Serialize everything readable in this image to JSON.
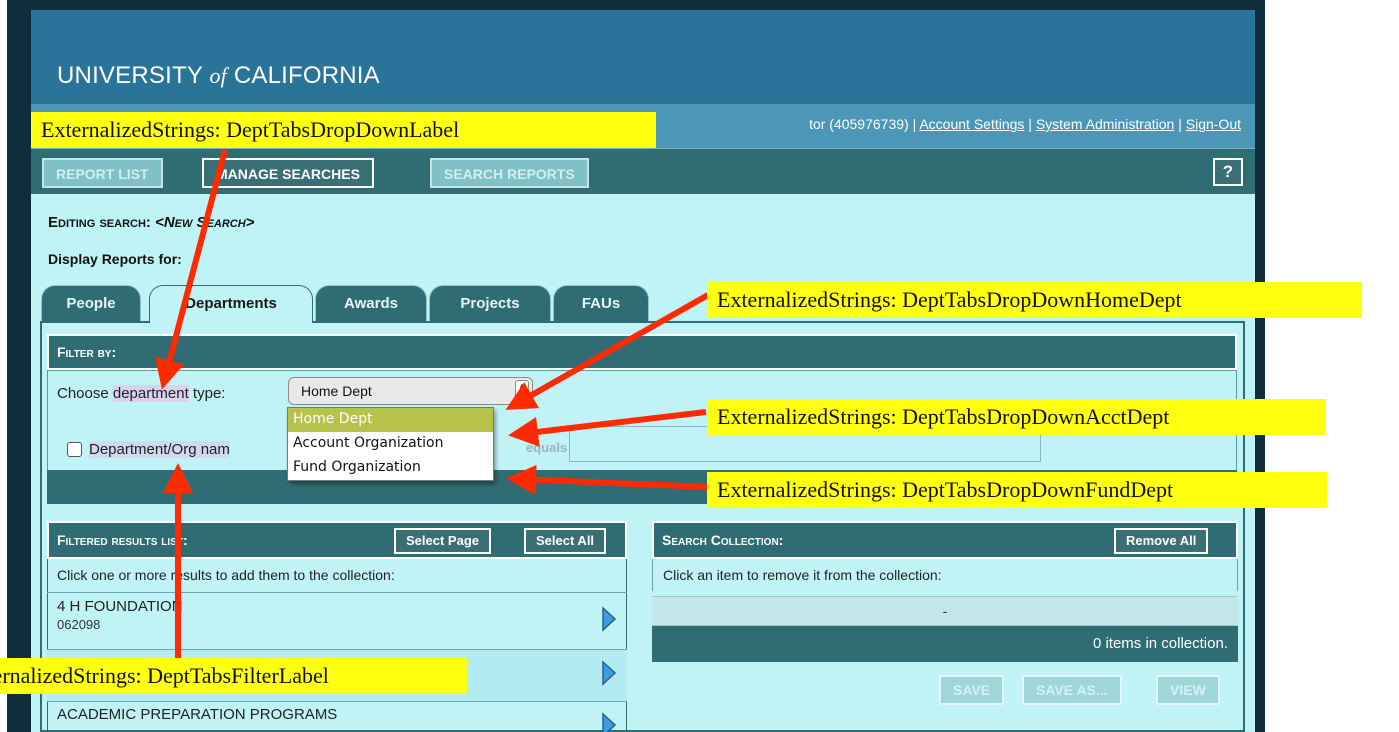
{
  "header": {
    "brand_part1": "UNIVERSITY",
    "brand_of": "of",
    "brand_part2": "CALIFORNIA",
    "user_text": "tor (405976739) | ",
    "account_settings": "Account Settings",
    "sep1": " | ",
    "system_admin": "System Administration",
    "sep2": " | ",
    "sign_out": "Sign-Out"
  },
  "nav": {
    "report_list": "REPORT LIST",
    "manage_searches": "MANAGE SEARCHES",
    "search_reports": "SEARCH REPORTS",
    "help": "?"
  },
  "editing": {
    "prefix": "Editing search: ",
    "name": "<New Search>"
  },
  "display_for": "Display Reports for:",
  "tabs": [
    {
      "label": "People"
    },
    {
      "label": "Departments"
    },
    {
      "label": "Awards"
    },
    {
      "label": "Projects"
    },
    {
      "label": "FAUs"
    }
  ],
  "filter": {
    "heading": "Filter by:",
    "choose_label_a": "Choose ",
    "choose_label_hl": "department",
    "choose_label_b": " type:",
    "select_value": "Home Dept",
    "options": [
      "Home Dept",
      "Account Organization",
      "Fund Organization"
    ],
    "dept_label_a": "Department/Org nam",
    "equals": "equals"
  },
  "results": {
    "heading": "Filtered results list:",
    "select_page": "Select Page",
    "select_all": "Select All",
    "instructions": "Click one or more results to add them to the collection:",
    "items": [
      {
        "name": "4 H FOUNDATION",
        "code": "062098"
      },
      {
        "name": "",
        "code": ""
      },
      {
        "name": "ACADEMIC PREPARATION PROGRAMS",
        "code": ""
      }
    ]
  },
  "collection": {
    "heading": "Search Collection:",
    "remove_all": "Remove All",
    "instructions": "Click an item to remove it from the collection:",
    "empty_marker": "-",
    "count_text": "0 items in collection.",
    "save": "SAVE",
    "save_as": "SAVE AS...",
    "view": "VIEW"
  },
  "annotations": {
    "label": "ExternalizedStrings: DeptTabsDropDownLabel",
    "home": "ExternalizedStrings: DeptTabsDropDownHomeDept",
    "acct": "ExternalizedStrings: DeptTabsDropDownAcctDept",
    "fund": "ExternalizedStrings: DeptTabsDropDownFundDept",
    "filter": "ExternalizedStrings: DeptTabsFilterLabel"
  },
  "colors": {
    "header": "#2b7499",
    "nav": "#2f6c73",
    "content": "#bff3f6",
    "annotation": "#ffff10",
    "arrow": "#ff2a00",
    "selected_option": "#b7c24a"
  }
}
